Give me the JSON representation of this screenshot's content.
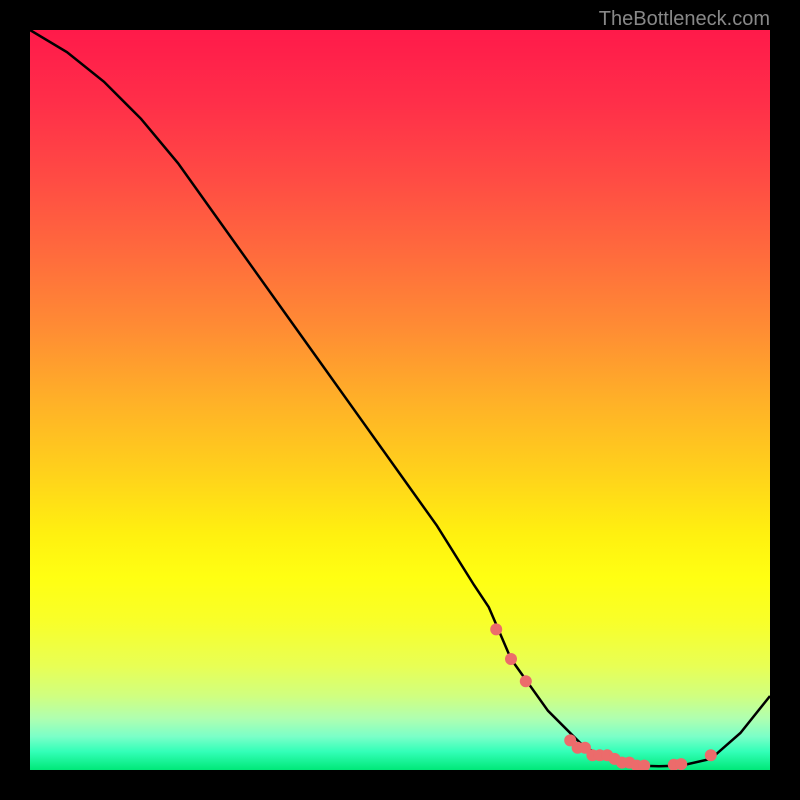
{
  "watermark": "TheBottleneck.com",
  "chart_data": {
    "type": "line",
    "title": "",
    "xlabel": "",
    "ylabel": "",
    "xlim": [
      0,
      100
    ],
    "ylim": [
      0,
      100
    ],
    "series": [
      {
        "name": "bottleneck-curve",
        "x": [
          0,
          5,
          10,
          15,
          20,
          25,
          30,
          35,
          40,
          45,
          50,
          55,
          60,
          62,
          65,
          70,
          75,
          80,
          82,
          85,
          88,
          92,
          96,
          100
        ],
        "values": [
          100,
          97,
          93,
          88,
          82,
          75,
          68,
          61,
          54,
          47,
          40,
          33,
          25,
          22,
          15,
          8,
          3,
          1,
          0.6,
          0.5,
          0.6,
          1.5,
          5,
          10
        ]
      }
    ],
    "markers": {
      "name": "highlight-dots",
      "x": [
        63,
        65,
        67,
        73,
        74,
        75,
        76,
        77,
        78,
        79,
        80,
        81,
        82,
        83,
        87,
        88,
        92
      ],
      "y": [
        19,
        15,
        12,
        4,
        3,
        3,
        2,
        2,
        2,
        1.5,
        1,
        1,
        0.6,
        0.6,
        0.7,
        0.8,
        2
      ],
      "color": "#ec6b6b",
      "radius": 6
    },
    "gradient_stops": [
      {
        "offset": 0.0,
        "color": "#ff1a4a"
      },
      {
        "offset": 0.1,
        "color": "#ff2f49"
      },
      {
        "offset": 0.2,
        "color": "#ff4b44"
      },
      {
        "offset": 0.3,
        "color": "#ff6a3d"
      },
      {
        "offset": 0.4,
        "color": "#ff8b34"
      },
      {
        "offset": 0.5,
        "color": "#ffb028"
      },
      {
        "offset": 0.6,
        "color": "#ffd21b"
      },
      {
        "offset": 0.68,
        "color": "#fff010"
      },
      {
        "offset": 0.74,
        "color": "#ffff12"
      },
      {
        "offset": 0.8,
        "color": "#f8ff2a"
      },
      {
        "offset": 0.86,
        "color": "#e8ff55"
      },
      {
        "offset": 0.9,
        "color": "#d0ff80"
      },
      {
        "offset": 0.93,
        "color": "#b0ffb0"
      },
      {
        "offset": 0.955,
        "color": "#7affc8"
      },
      {
        "offset": 0.975,
        "color": "#33ffb8"
      },
      {
        "offset": 1.0,
        "color": "#00e878"
      }
    ]
  }
}
